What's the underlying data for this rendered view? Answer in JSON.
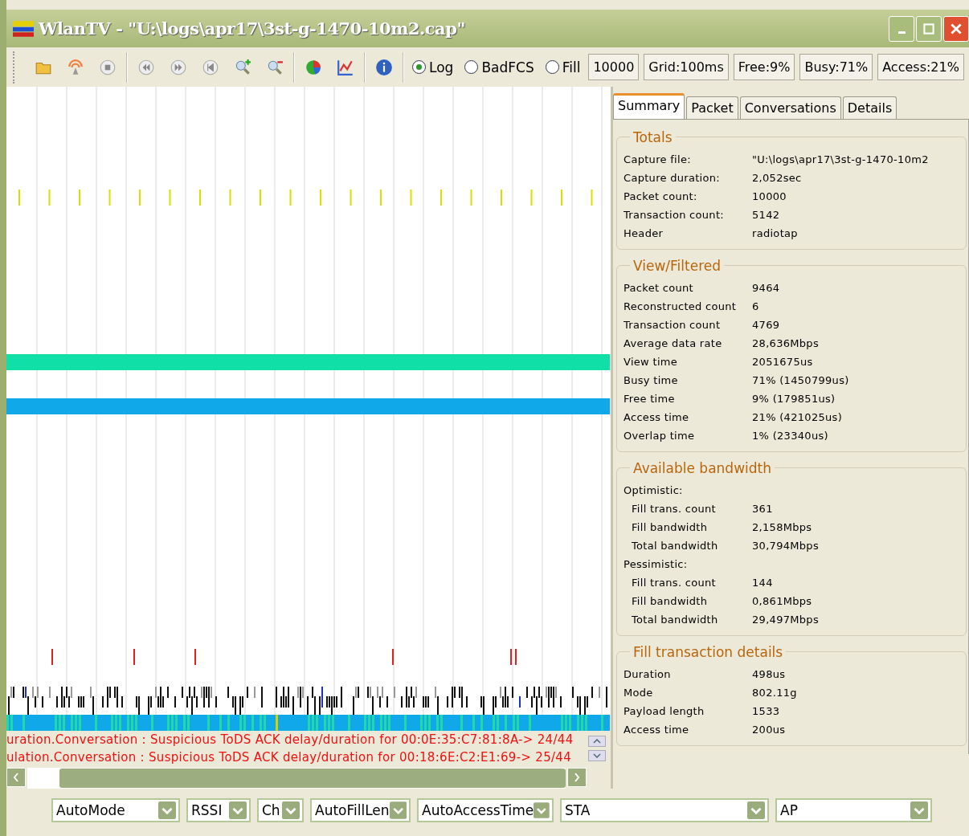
{
  "window": {
    "title": "WlanTV - \"U:\\logs\\apr17\\3st-g-1470-10m2.cap\""
  },
  "toolbar": {
    "radios": [
      {
        "label": "Log",
        "selected": true
      },
      {
        "label": "BadFCS",
        "selected": false
      },
      {
        "label": "Fill",
        "selected": false
      }
    ],
    "boxes": [
      "10000",
      "Grid:100ms",
      "Free:9%",
      "Busy:71%",
      "Access:21%"
    ]
  },
  "log": [
    "uration.Conversation : Suspicious ToDS ACK delay/duration for 00:0E:35:C7:81:8A-> 24/44",
    "ulation.Conversation : Suspicious ToDS ACK delay/duration for 00:18:6E:C2:E1:69-> 25/44"
  ],
  "tabs": [
    {
      "label": "Summary",
      "selected": true
    },
    {
      "label": "Packet",
      "selected": false
    },
    {
      "label": "Conversations",
      "selected": false
    },
    {
      "label": "Details",
      "selected": false
    }
  ],
  "groups": [
    {
      "title": "Totals",
      "rows": [
        {
          "label": "Capture file:",
          "value": "\"U:\\logs\\apr17\\3st-g-1470-10m2"
        },
        {
          "label": "Capture duration:",
          "value": "2,052sec"
        },
        {
          "label": "Packet count:",
          "value": "10000"
        },
        {
          "label": "Transaction count:",
          "value": "5142"
        },
        {
          "label": "Header",
          "value": "radiotap"
        }
      ]
    },
    {
      "title": "View/Filtered",
      "rows": [
        {
          "label": "Packet count",
          "value": "9464"
        },
        {
          "label": "Reconstructed count",
          "value": "6"
        },
        {
          "label": "Transaction count",
          "value": "4769"
        },
        {
          "label": "Average data rate",
          "value": "28,636Mbps"
        },
        {
          "label": "View time",
          "value": "2051675us"
        },
        {
          "label": "Busy time",
          "value": "71% (1450799us)"
        },
        {
          "label": "Free time",
          "value": "9% (179851us)"
        },
        {
          "label": "Access time",
          "value": "21% (421025us)"
        },
        {
          "label": "Overlap time",
          "value": "1% (23340us)"
        }
      ]
    },
    {
      "title": "Available bandwidth",
      "rows": [
        {
          "label": "Optimistic:",
          "children": [
            {
              "label": "Fill trans. count",
              "value": "361"
            },
            {
              "label": "Fill bandwidth",
              "value": "2,158Mbps"
            },
            {
              "label": "Total bandwidth",
              "value": "30,794Mbps"
            }
          ]
        },
        {
          "label": "Pessimistic:",
          "children": [
            {
              "label": "Fill trans. count",
              "value": "144"
            },
            {
              "label": "Fill bandwidth",
              "value": "0,861Mbps"
            },
            {
              "label": "Total bandwidth",
              "value": "29,497Mbps"
            }
          ]
        }
      ]
    },
    {
      "title": "Fill transaction details",
      "rows": [
        {
          "label": "Duration",
          "value": "498us"
        },
        {
          "label": "Mode",
          "value": "802.11g"
        },
        {
          "label": "Payload length",
          "value": "1533"
        },
        {
          "label": "Access time",
          "value": "200us"
        }
      ]
    }
  ],
  "dropdowns": [
    {
      "value": "AutoMode"
    },
    {
      "value": "RSSI"
    },
    {
      "value": "Ch"
    },
    {
      "value": "AutoFillLen"
    },
    {
      "value": "AutoAccessTime"
    },
    {
      "value": "STA"
    },
    {
      "value": "AP"
    }
  ]
}
